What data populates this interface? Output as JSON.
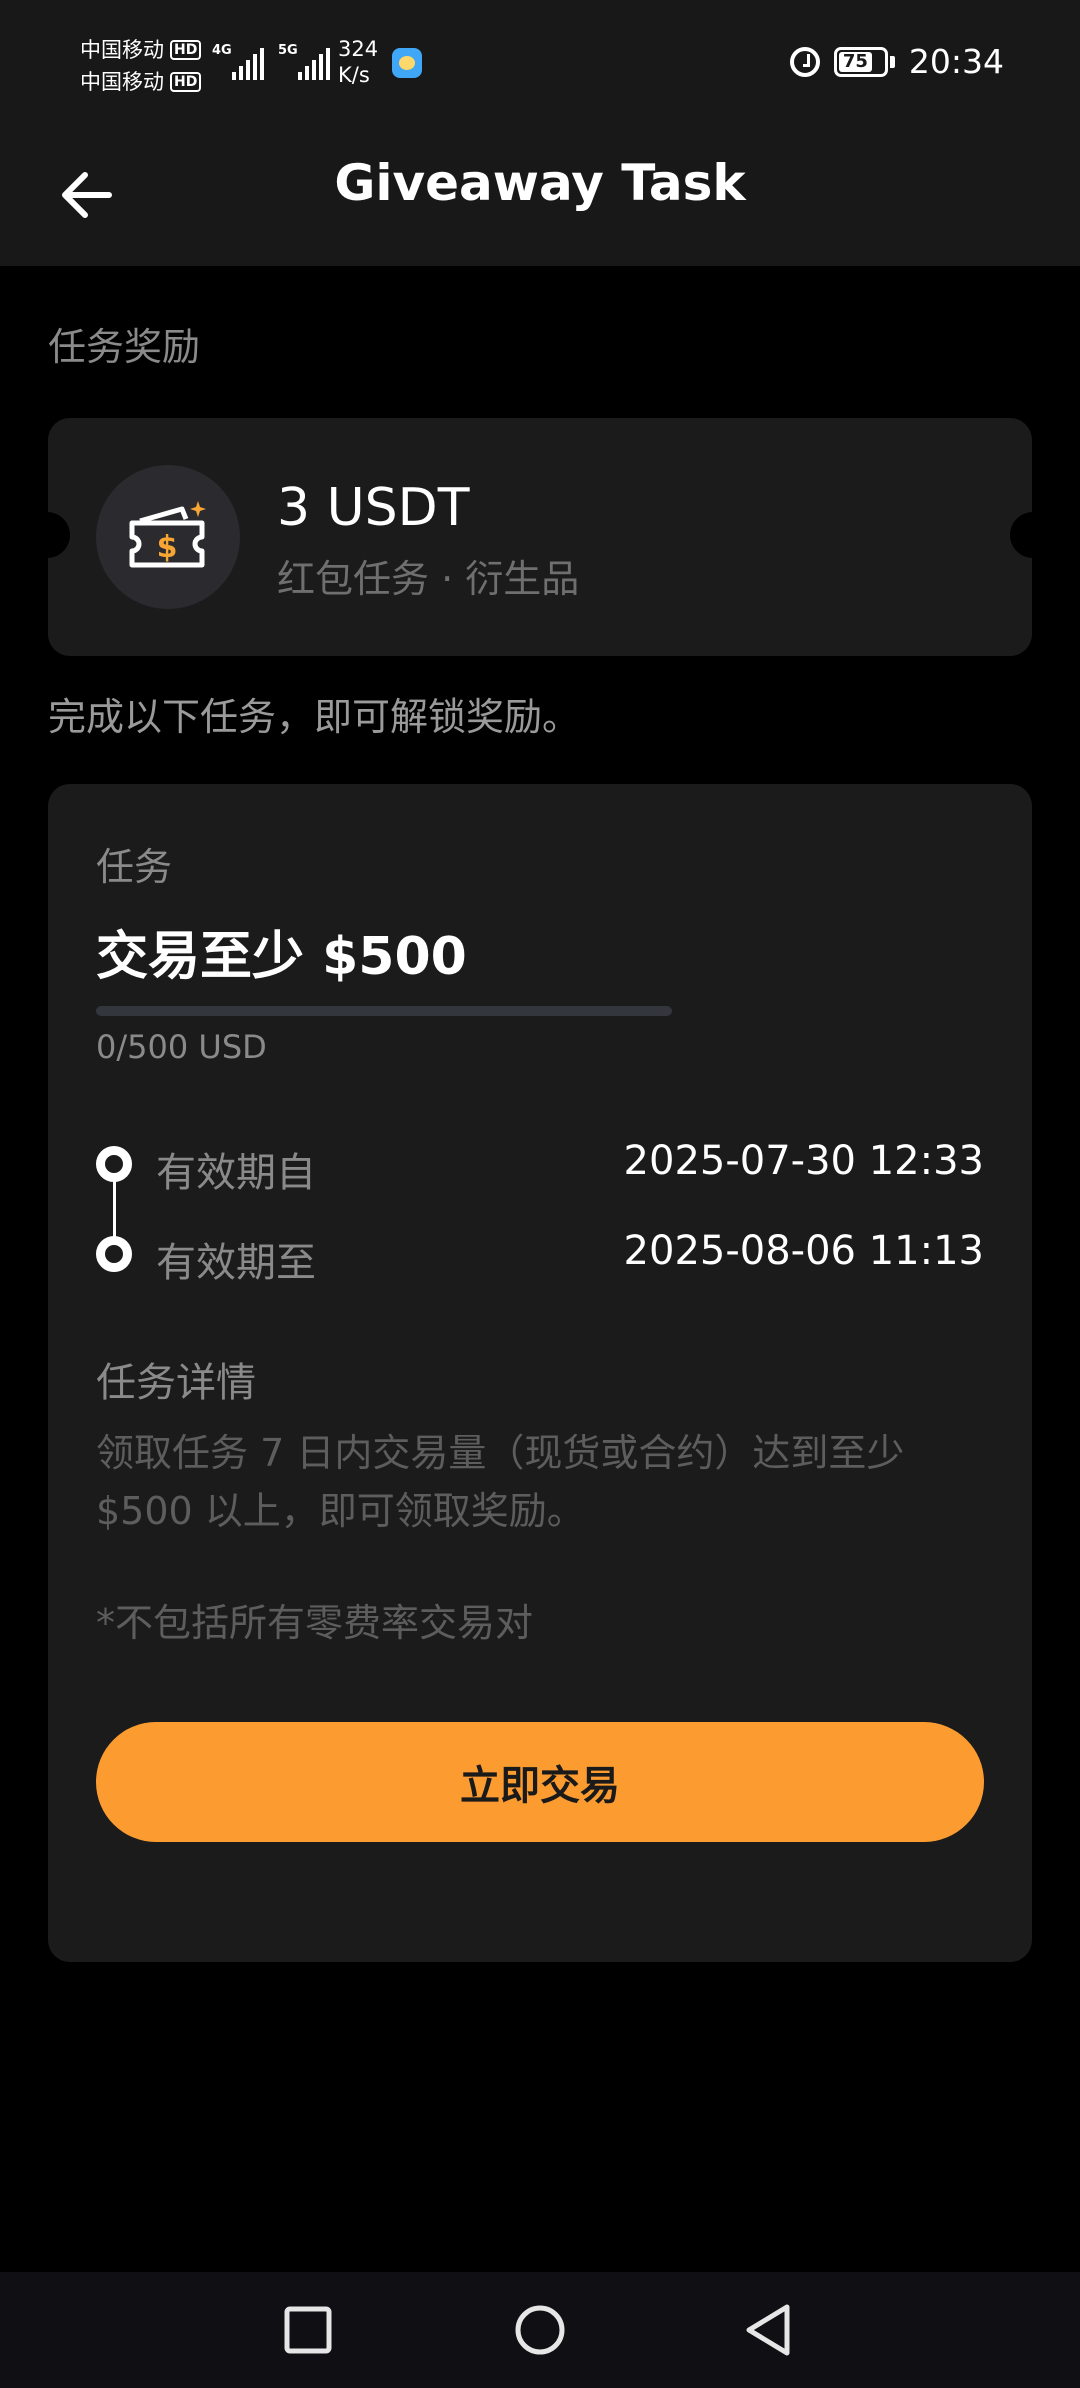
{
  "status_bar": {
    "carrier_1": "中国移动",
    "carrier_2": "中国移动",
    "hd": "HD",
    "network_1": "4G",
    "network_2": "5G",
    "speed_value": "324",
    "speed_unit": "K/s",
    "battery_level": "75",
    "time": "20:34"
  },
  "header": {
    "title": "Giveaway Task"
  },
  "reward_section": {
    "label": "任务奖励",
    "amount": "3 USDT",
    "subtitle": "红包任务 · 衍生品",
    "icon": "ticket-dollar-icon"
  },
  "unlock_hint": "完成以下任务，即可解锁奖励。",
  "task": {
    "label": "任务",
    "title": "交易至少 $500",
    "progress_fraction": 0,
    "progress_text": "0/500 USD",
    "valid_from_label": "有效期自",
    "valid_from_value": "2025-07-30 12:33",
    "valid_to_label": "有效期至",
    "valid_to_value": "2025-08-06 11:13",
    "details_label": "任务详情",
    "details_text": "领取任务 7 日内交易量（现货或合约）达到至少 $500 以上，即可领取奖励。",
    "details_note": "*不包括所有零费率交易对",
    "button_label": "立即交易"
  },
  "colors": {
    "accent": "#fc9c30",
    "background": "#000000",
    "card": "#1b1b1b"
  }
}
